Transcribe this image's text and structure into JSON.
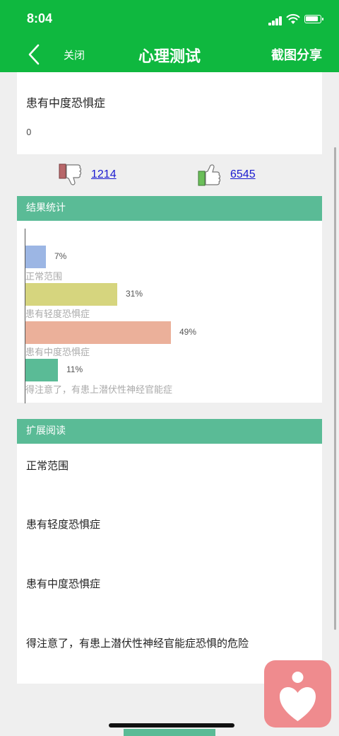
{
  "status": {
    "time": "8:04"
  },
  "nav": {
    "close_label": "关闭",
    "title": "心理测试",
    "share_label": "截图分享"
  },
  "result": {
    "text": "患有中度恐惧症",
    "number": "0"
  },
  "votes": {
    "dislike_count": "1214",
    "like_count": "6545"
  },
  "stats": {
    "header": "结果统计",
    "chart_data": {
      "type": "bar",
      "orientation": "horizontal",
      "categories": [
        "正常范围",
        "患有轻度恐惧症",
        "患有中度恐惧症",
        "得注意了，有患上潜伏性神经官能症"
      ],
      "values": [
        7,
        31,
        49,
        11
      ],
      "labels": [
        "7%",
        "31%",
        "49%",
        "11%"
      ],
      "colors": [
        "#9cb6e4",
        "#d6d57e",
        "#ebb09a",
        "#5abb96"
      ]
    }
  },
  "extended": {
    "header": "扩展阅读",
    "items": [
      "正常范围",
      "患有轻度恐惧症",
      "患有中度恐惧症",
      "得注意了，有患上潜伏性神经官能症恐惧的危险"
    ]
  },
  "colors": {
    "nav_green": "#0fb83f",
    "header_green": "#5abb96",
    "link_blue": "#1a1ad0",
    "heart_button": "#ef8b8e"
  }
}
